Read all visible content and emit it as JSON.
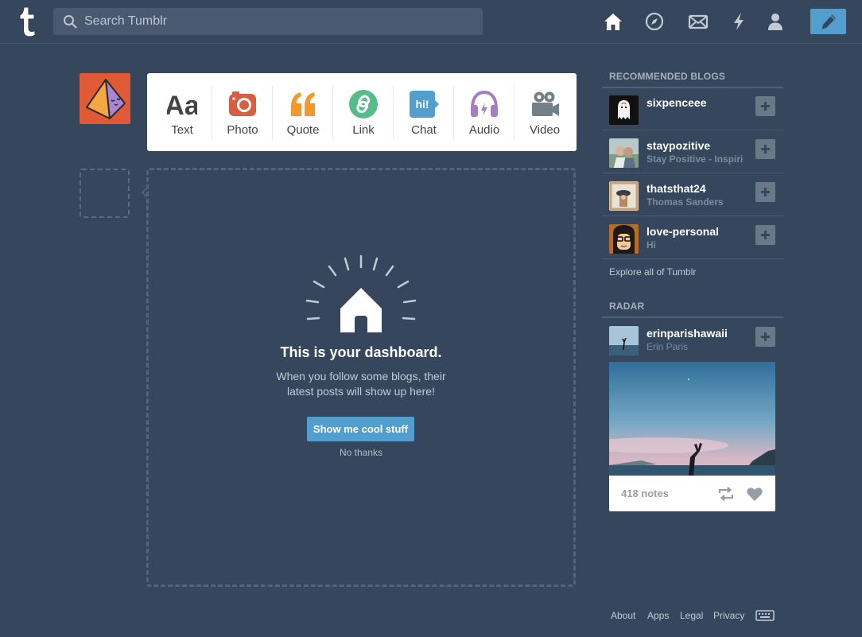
{
  "header": {
    "search_placeholder": "Search Tumblr",
    "nav": [
      "home-icon",
      "explore-icon",
      "inbox-icon",
      "activity-icon",
      "account-icon"
    ],
    "compose_icon": "pencil-icon"
  },
  "post_types": [
    {
      "label": "Text",
      "icon": "text-icon",
      "color": "#444444"
    },
    {
      "label": "Photo",
      "icon": "camera-icon",
      "color": "#d95e40"
    },
    {
      "label": "Quote",
      "icon": "quote-icon",
      "color": "#f2992e"
    },
    {
      "label": "Link",
      "icon": "link-icon",
      "color": "#56bc8a"
    },
    {
      "label": "Chat",
      "icon": "chat-icon",
      "color": "#529ecc"
    },
    {
      "label": "Audio",
      "icon": "headphones-icon",
      "color": "#a77dc2"
    },
    {
      "label": "Video",
      "icon": "video-camera-icon",
      "color": "#748089"
    }
  ],
  "empty_state": {
    "title": "This is your dashboard.",
    "text": "When you follow some blogs, their latest posts will show up here!",
    "button": "Show me cool stuff",
    "dismiss": "No thanks"
  },
  "sidebar": {
    "recommended_heading": "RECOMMENDED BLOGS",
    "blogs": [
      {
        "name": "sixpenceee",
        "subtitle": ""
      },
      {
        "name": "staypozitive",
        "subtitle": "Stay Positive - Inspiri"
      },
      {
        "name": "thatsthat24",
        "subtitle": "Thomas Sanders"
      },
      {
        "name": "love-personal",
        "subtitle": "Hi"
      }
    ],
    "explore_link": "Explore all of Tumblr",
    "radar_heading": "RADAR",
    "radar": {
      "name": "erinparishawaii",
      "subtitle": "Erin Paris",
      "notes": "418 notes"
    }
  },
  "footer": {
    "links": [
      "About",
      "Apps",
      "Legal",
      "Privacy"
    ],
    "keyboard_icon": "keyboard-icon"
  },
  "colors": {
    "background": "#36465d",
    "accent": "#529ecc",
    "avatar": "#e05a36"
  }
}
